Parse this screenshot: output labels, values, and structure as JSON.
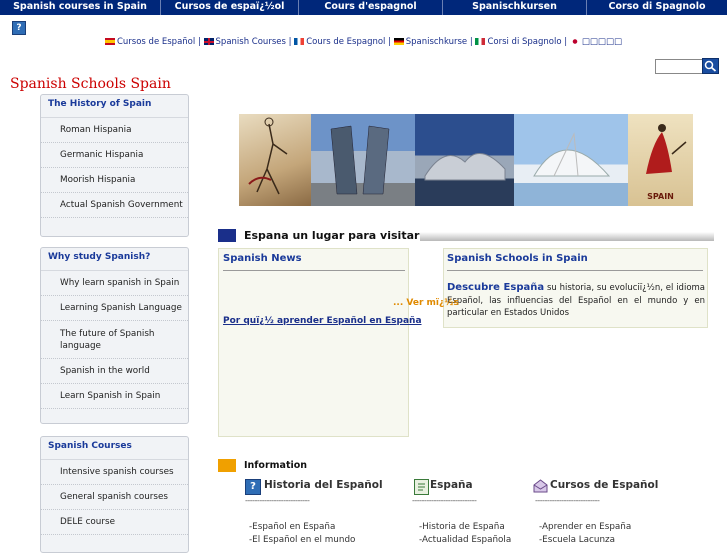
{
  "top_nav": [
    {
      "label": "Spanish courses in Spain"
    },
    {
      "label": "Cursos de espaï¿½ol"
    },
    {
      "label": "Cours d'espagnol"
    },
    {
      "label": "Spanischkursen"
    },
    {
      "label": "Corso di Spagnolo"
    }
  ],
  "help_icon_glyph": "?",
  "lang_bar": {
    "items": [
      {
        "label": "Cursos de Español",
        "flag": "spain-flag"
      },
      {
        "label": "Spanish Courses",
        "flag": "uk-flag"
      },
      {
        "label": "Cours de Espagnol",
        "flag": "france-flag"
      },
      {
        "label": "Spanischkurse",
        "flag": "germany-flag"
      },
      {
        "label": "Corsi di Spagnolo",
        "flag": "italy-flag"
      },
      {
        "label": "□□□□□",
        "flag": "japan-flag"
      }
    ],
    "separator": "|"
  },
  "search": {
    "value": "",
    "placeholder": ""
  },
  "site_title": "Spanish Schools Spain",
  "sidebar": {
    "history": {
      "title": "The History of Spain",
      "items": [
        "Roman Hispania",
        "Germanic Hispania",
        "Moorish Hispania",
        "Actual Spanish Government"
      ]
    },
    "why": {
      "title": "Why study Spanish?",
      "items": [
        "Why learn spanish in Spain",
        "Learning Spanish Language",
        "The future of Spanish language",
        "Spanish in the world",
        "Learn Spanish in Spain"
      ]
    },
    "courses": {
      "title": "Spanish Courses",
      "items": [
        "Intensive spanish courses",
        "General spanish courses",
        "DELE course"
      ]
    }
  },
  "banner_caption": "SPAIN",
  "section_heading": "Espana un lugar para visitar",
  "news": {
    "title": "Spanish News",
    "more": "... Ver mï¿½s",
    "link": "Por quï¿½ aprender Español en España"
  },
  "schools": {
    "title": "Spanish Schools in Spain",
    "lead": "Descubre España",
    "text": "su historia, su evoluciï¿½n, el idioma Español, las influencias del Español en el mundo y en particular en Estados Unidos"
  },
  "information": {
    "label": "Information",
    "dashes": "---------------------------",
    "columns": [
      {
        "title": "Historia del Español",
        "icon": "help-book-icon",
        "links": [
          "-Español en España",
          "-El Español en el mundo"
        ]
      },
      {
        "title": "España",
        "icon": "document-edit-icon",
        "links": [
          "-Historia de España",
          "-Actualidad Española"
        ]
      },
      {
        "title": "Cursos de Español",
        "icon": "mail-open-icon",
        "links": [
          "-Aprender en España",
          "-Escuela Lacunza"
        ]
      }
    ]
  },
  "colors": {
    "nav_bg": "#00277a",
    "title_red": "#cc0000",
    "link_blue": "#1a3a9a",
    "more_orange": "#e08a00",
    "info_square": "#f0a000",
    "heading_square": "#1a2f8a"
  }
}
